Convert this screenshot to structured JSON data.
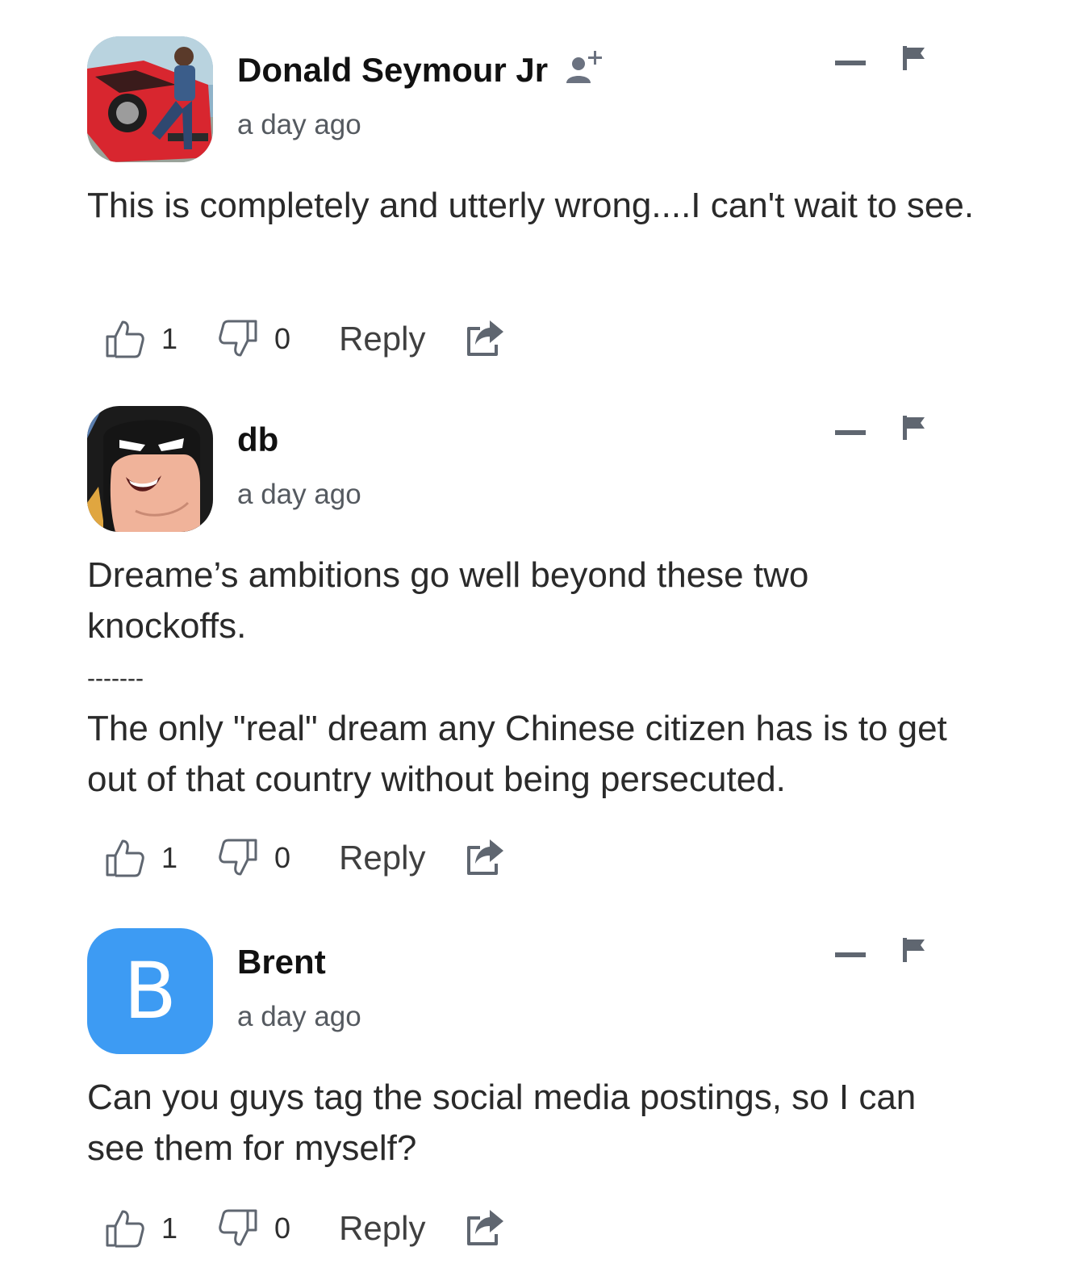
{
  "comments": [
    {
      "author": "Donald Seymour Jr",
      "show_follow_icon": true,
      "timestamp": "a day ago",
      "paragraphs": [
        "This is completely and utterly wrong....I can't wait to see."
      ],
      "likes": "1",
      "dislikes": "0",
      "reply_label": "Reply",
      "avatar_icon": "photo-avatar"
    },
    {
      "author": "db",
      "show_follow_icon": false,
      "timestamp": "a day ago",
      "paragraphs": [
        "Dreame’s ambitions go well beyond these two knockoffs.",
        "-------",
        "The only \"real\" dream any Chinese citizen has is to get out of that country without being persecuted."
      ],
      "likes": "1",
      "dislikes": "0",
      "reply_label": "Reply",
      "avatar_icon": "cartoon-avatar"
    },
    {
      "author": "Brent",
      "show_follow_icon": false,
      "timestamp": "a day ago",
      "paragraphs": [
        "Can you guys tag the social media postings, so I can see them for myself?"
      ],
      "likes": "1",
      "dislikes": "0",
      "reply_label": "Reply",
      "avatar_letter": "B",
      "avatar_color": "#3d9bf3"
    }
  ],
  "colors": {
    "icon_gray": "#5f6670",
    "text": "#2a2a2a",
    "author": "#111111"
  }
}
